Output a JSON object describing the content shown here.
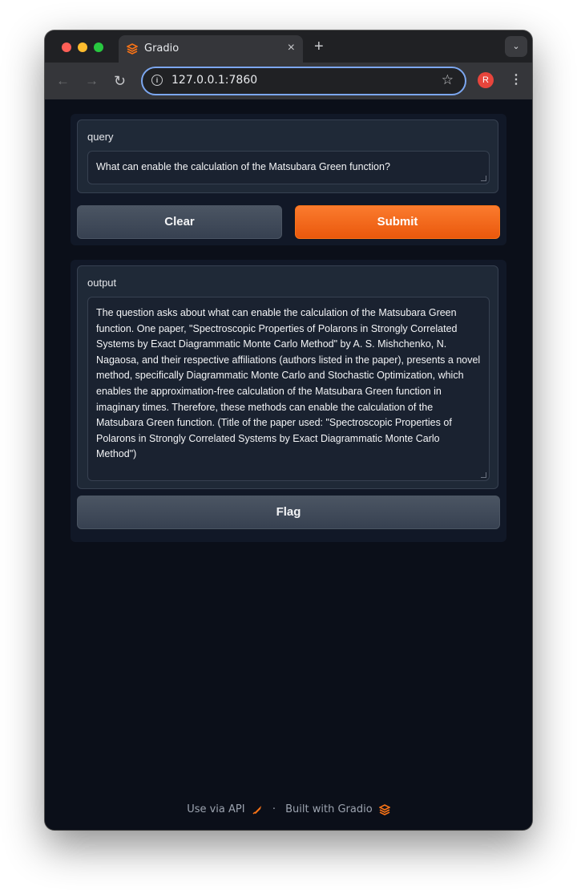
{
  "browser": {
    "tab_title": "Gradio",
    "tab_close": "×",
    "new_tab": "+",
    "tab_menu": "⌄",
    "url": "127.0.0.1:7860",
    "profile_initial": "R",
    "accent": "#7ca7f0"
  },
  "app": {
    "query": {
      "label": "query",
      "value": "What can enable the calculation of the Matsubara Green function?"
    },
    "buttons": {
      "clear": "Clear",
      "submit": "Submit",
      "flag": "Flag"
    },
    "output": {
      "label": "output",
      "value": "The question asks about what can enable the calculation of the Matsubara Green function. One paper, \"Spectroscopic Properties of Polarons in Strongly Correlated Systems by Exact Diagrammatic Monte Carlo Method\" by A. S. Mishchenko, N. Nagaosa, and their respective affiliations (authors listed in the paper), presents a novel method, specifically Diagrammatic Monte Carlo and Stochastic Optimization, which enables the approximation-free calculation of the Matsubara Green function in imaginary times. Therefore, these methods can enable the calculation of the Matsubara Green function. (Title of the paper used: \"Spectroscopic Properties of Polarons in Strongly Correlated Systems by Exact Diagrammatic Monte Carlo Method\")"
    },
    "colors": {
      "primary": "#f97316",
      "background": "#0b0f19"
    }
  },
  "footer": {
    "api_link": "Use via API",
    "separator": "·",
    "built_with": "Built with Gradio"
  }
}
